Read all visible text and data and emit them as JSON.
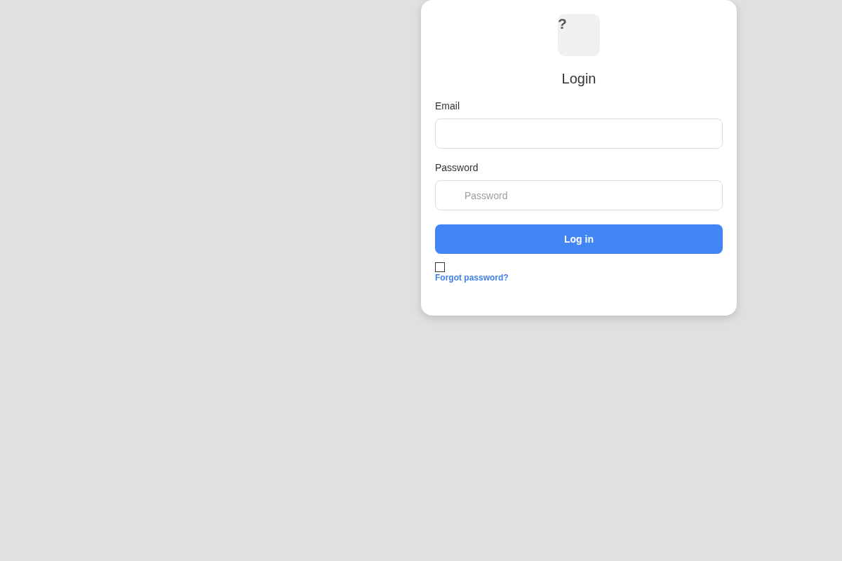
{
  "logo": {
    "glyph": "?"
  },
  "title": "Login",
  "email": {
    "label": "Email"
  },
  "password": {
    "label": "Password",
    "placeholder": "Password"
  },
  "submit": {
    "label": "Log in"
  },
  "remember": {
    "checked": false
  },
  "forgot_link": "Forgot password?"
}
